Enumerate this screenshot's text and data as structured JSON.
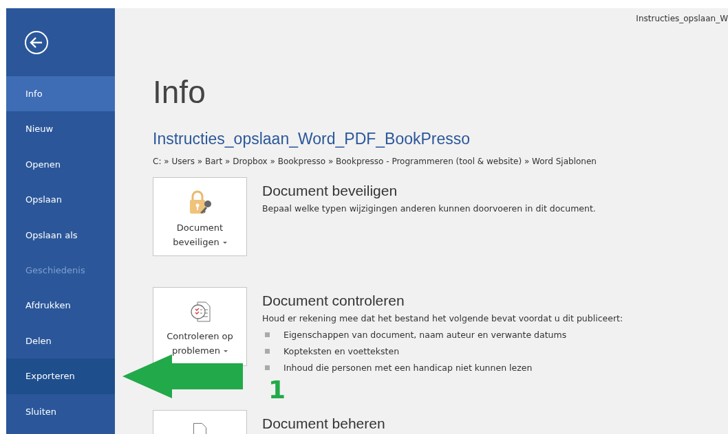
{
  "window": {
    "title": "Instructies_opslaan_W"
  },
  "sidebar": {
    "items": [
      {
        "label": "Info",
        "selected": true,
        "disabled": false
      },
      {
        "label": "Nieuw",
        "selected": false,
        "disabled": false
      },
      {
        "label": "Openen",
        "selected": false,
        "disabled": false
      },
      {
        "label": "Opslaan",
        "selected": false,
        "disabled": false
      },
      {
        "label": "Opslaan als",
        "selected": false,
        "disabled": false
      },
      {
        "label": "Geschiedenis",
        "selected": false,
        "disabled": true
      },
      {
        "label": "Afdrukken",
        "selected": false,
        "disabled": false
      },
      {
        "label": "Delen",
        "selected": false,
        "disabled": false
      },
      {
        "label": "Exporteren",
        "selected": false,
        "hovered": true,
        "disabled": false
      },
      {
        "label": "Sluiten",
        "selected": false,
        "disabled": false
      }
    ]
  },
  "page": {
    "heading": "Info",
    "document_name": "Instructies_opslaan_Word_PDF_BookPresso",
    "path": "C: » Users » Bart » Dropbox » Bookpresso » Bookpresso - Programmeren (tool & website) » Word Sjablonen",
    "sections": [
      {
        "kind": "protect",
        "button": "Document beveiligen",
        "title": "Document beveiligen",
        "description": "Bepaal welke typen wijzigingen anderen kunnen doorvoeren in dit document."
      },
      {
        "kind": "inspect",
        "button": "Controleren op problemen",
        "title": "Document controleren",
        "description": "Houd er rekening mee dat het bestand het volgende bevat voordat u dit publiceert:",
        "bullets": [
          "Eigenschappen van document, naam auteur en verwante datums",
          "Kopteksten en voetteksten",
          "Inhoud die personen met een handicap niet kunnen lezen"
        ]
      },
      {
        "kind": "manage",
        "title": "Document beheren"
      }
    ]
  },
  "annotation": {
    "label": "1"
  }
}
